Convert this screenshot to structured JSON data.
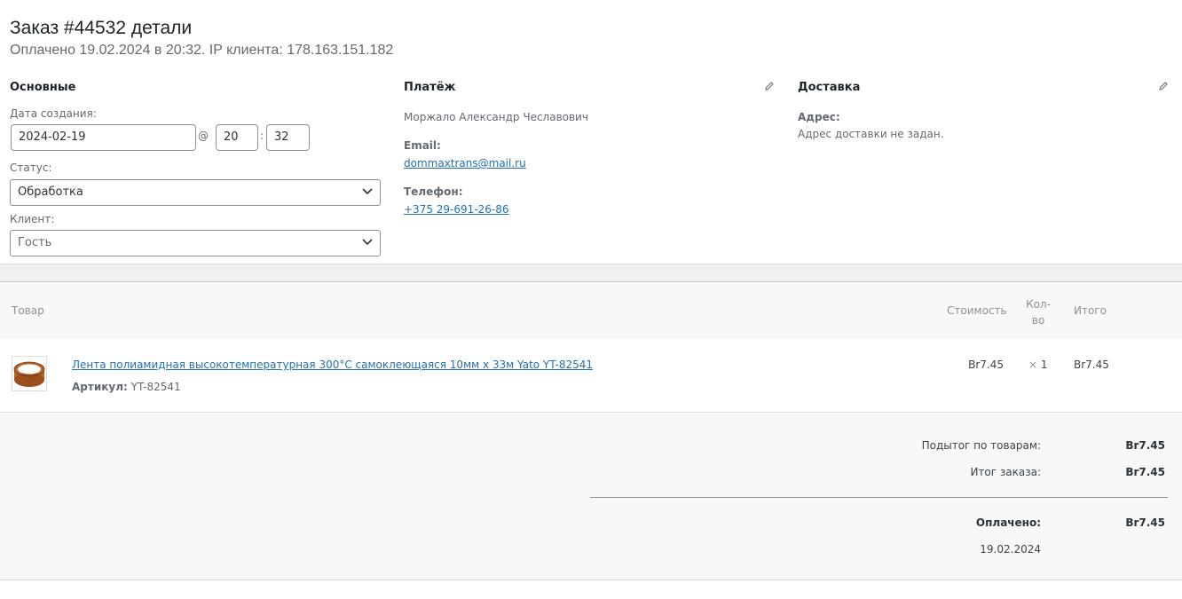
{
  "header": {
    "title": "Заказ #44532 детали",
    "subtitle": "Оплачено 19.02.2024 в 20:32. IP клиента: 178.163.151.182"
  },
  "general": {
    "heading": "Основные",
    "date_label": "Дата создания:",
    "date_value": "2024-02-19",
    "at_sign": "@",
    "hour_value": "20",
    "colon": ":",
    "minute_value": "32",
    "status_label": "Статус:",
    "status_value": "Обработка",
    "customer_label": "Клиент:",
    "customer_value": "Гость"
  },
  "billing": {
    "heading": "Платёж",
    "name": "Моржало Александр Чеславович",
    "email_label": "Email:",
    "email_value": "dommaxtrans@mail.ru",
    "phone_label": "Телефон:",
    "phone_value": "+375 29-691-26-86",
    "edit_icon": "pencil-icon"
  },
  "shipping": {
    "heading": "Доставка",
    "address_label": "Адрес:",
    "address_value": "Адрес доставки не задан.",
    "edit_icon": "pencil-icon"
  },
  "items_table": {
    "columns": {
      "product": "Товар",
      "cost": "Стоимость",
      "qty_line1": "Кол-",
      "qty_line2": "во",
      "total": "Итого"
    },
    "rows": [
      {
        "name": "Лента полиамидная высокотемпературная 300°C самоклеющаяся 10мм x 33м Yato YT-82541",
        "sku_label": "Артикул:",
        "sku_value": "YT-82541",
        "cost": "Br7.45",
        "qty_prefix": "×",
        "qty": "1",
        "total": "Br7.45"
      }
    ]
  },
  "totals": {
    "subtotal_label": "Подытог по товарам:",
    "subtotal_value": "Br7.45",
    "order_total_label": "Итог заказа:",
    "order_total_value": "Br7.45",
    "paid_label": "Оплачено:",
    "paid_value": "Br7.45",
    "paid_date": "19.02.2024"
  },
  "colors": {
    "link": "#2271b1",
    "border": "#8c8f94",
    "panel_bg": "#f8f8f8"
  }
}
